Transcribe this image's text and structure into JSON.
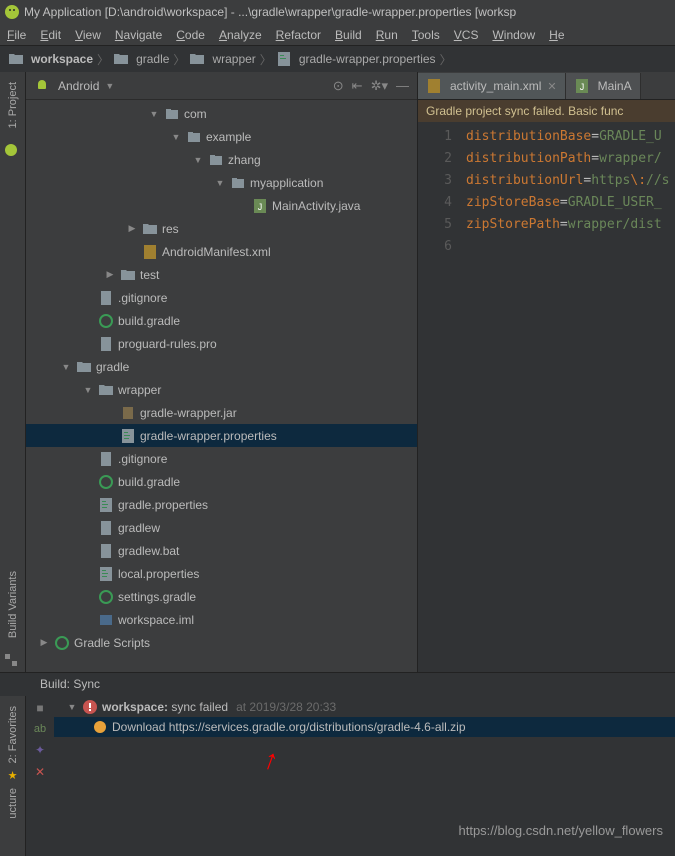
{
  "title": "My Application [D:\\android\\workspace] - ...\\gradle\\wrapper\\gradle-wrapper.properties [worksp",
  "menubar": [
    "File",
    "Edit",
    "View",
    "Navigate",
    "Code",
    "Analyze",
    "Refactor",
    "Build",
    "Run",
    "Tools",
    "VCS",
    "Window",
    "He"
  ],
  "breadcrumb": {
    "items": [
      "workspace",
      "gradle",
      "wrapper",
      "gradle-wrapper.properties"
    ]
  },
  "leftrail": {
    "project": "1: Project",
    "buildvariants": "Build Variants"
  },
  "project_panel": {
    "title": "Android",
    "toolbar_icons": [
      "target-icon",
      "collapse-icon",
      "gear-icon",
      "hide-icon"
    ]
  },
  "tree": [
    {
      "indent": 5,
      "twisty": "▼",
      "icon": "pkg",
      "label": "com"
    },
    {
      "indent": 6,
      "twisty": "▼",
      "icon": "pkg",
      "label": "example"
    },
    {
      "indent": 7,
      "twisty": "▼",
      "icon": "pkg",
      "label": "zhang"
    },
    {
      "indent": 8,
      "twisty": "▼",
      "icon": "pkg",
      "label": "myapplication"
    },
    {
      "indent": 9,
      "twisty": "",
      "icon": "java",
      "label": "MainActivity.java"
    },
    {
      "indent": 4,
      "twisty": "▶",
      "icon": "dir",
      "label": "res"
    },
    {
      "indent": 4,
      "twisty": "",
      "icon": "xml",
      "label": "AndroidManifest.xml"
    },
    {
      "indent": 3,
      "twisty": "▶",
      "icon": "dir",
      "label": "test"
    },
    {
      "indent": 2,
      "twisty": "",
      "icon": "file",
      "label": ".gitignore"
    },
    {
      "indent": 2,
      "twisty": "",
      "icon": "gradle",
      "label": "build.gradle"
    },
    {
      "indent": 2,
      "twisty": "",
      "icon": "file",
      "label": "proguard-rules.pro"
    },
    {
      "indent": 1,
      "twisty": "▼",
      "icon": "dir",
      "label": "gradle"
    },
    {
      "indent": 2,
      "twisty": "▼",
      "icon": "dir",
      "label": "wrapper"
    },
    {
      "indent": 3,
      "twisty": "",
      "icon": "jar",
      "label": "gradle-wrapper.jar"
    },
    {
      "indent": 3,
      "twisty": "",
      "icon": "prop",
      "label": "gradle-wrapper.properties",
      "selected": true
    },
    {
      "indent": 2,
      "twisty": "",
      "icon": "file",
      "label": ".gitignore"
    },
    {
      "indent": 2,
      "twisty": "",
      "icon": "gradle",
      "label": "build.gradle"
    },
    {
      "indent": 2,
      "twisty": "",
      "icon": "prop",
      "label": "gradle.properties"
    },
    {
      "indent": 2,
      "twisty": "",
      "icon": "file",
      "label": "gradlew"
    },
    {
      "indent": 2,
      "twisty": "",
      "icon": "file",
      "label": "gradlew.bat"
    },
    {
      "indent": 2,
      "twisty": "",
      "icon": "prop",
      "label": "local.properties"
    },
    {
      "indent": 2,
      "twisty": "",
      "icon": "gradle",
      "label": "settings.gradle"
    },
    {
      "indent": 2,
      "twisty": "",
      "icon": "iml",
      "label": "workspace.iml"
    },
    {
      "indent": 0,
      "twisty": "▶",
      "icon": "gradle",
      "label": "Gradle Scripts"
    }
  ],
  "editor": {
    "tabs": [
      {
        "icon": "xml",
        "label": "activity_main.xml",
        "close": true,
        "active": true
      },
      {
        "icon": "java",
        "label": "MainA",
        "close": false,
        "active": false
      }
    ],
    "warning": "Gradle project sync failed. Basic func",
    "code": [
      {
        "n": "1",
        "segments": [
          {
            "t": "distributionBase",
            "c": "k"
          },
          {
            "t": "=",
            "c": ""
          },
          {
            "t": "GRADLE_U",
            "c": "v"
          }
        ]
      },
      {
        "n": "2",
        "segments": [
          {
            "t": "distributionPath",
            "c": "k"
          },
          {
            "t": "=",
            "c": ""
          },
          {
            "t": "wrapper/",
            "c": "v"
          }
        ]
      },
      {
        "n": "3",
        "segments": [
          {
            "t": "distributionUrl",
            "c": "k"
          },
          {
            "t": "=",
            "c": ""
          },
          {
            "t": "https",
            "c": "v"
          },
          {
            "t": "\\:",
            "c": "esc"
          },
          {
            "t": "//s",
            "c": "v"
          }
        ]
      },
      {
        "n": "4",
        "segments": [
          {
            "t": "zipStoreBase",
            "c": "k"
          },
          {
            "t": "=",
            "c": ""
          },
          {
            "t": "GRADLE_USER_",
            "c": "v"
          }
        ]
      },
      {
        "n": "5",
        "segments": [
          {
            "t": "zipStorePath",
            "c": "k"
          },
          {
            "t": "=",
            "c": ""
          },
          {
            "t": "wrapper/dist",
            "c": "v"
          }
        ]
      },
      {
        "n": "6",
        "segments": []
      }
    ]
  },
  "build": {
    "header": "Build: Sync",
    "root": {
      "label_bold": "workspace:",
      "label_rest": " sync failed",
      "timestamp": "at 2019/3/28 20:33"
    },
    "download": "Download https://services.gradle.org/distributions/gradle-4.6-all.zip"
  },
  "favorites": "2: Favorites",
  "structure": "ucture",
  "watermark": "https://blog.csdn.net/yellow_flowers"
}
